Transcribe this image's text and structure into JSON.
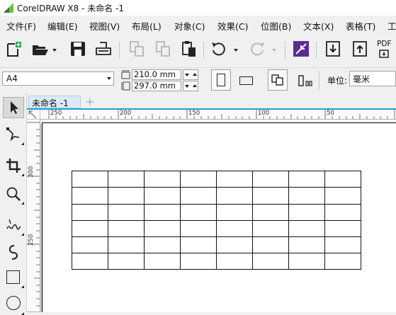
{
  "window": {
    "title": "CorelDRAW X8 - 未命名 -1"
  },
  "menu": [
    "文件(F)",
    "编辑(E)",
    "视图(V)",
    "布局(L)",
    "对象(C)",
    "效果(C)",
    "位图(B)",
    "文本(X)",
    "表格(T)",
    "工"
  ],
  "toolbar": {
    "buttons": [
      "new-document",
      "open",
      "save",
      "print",
      "import-disabled",
      "export-disabled",
      "paste",
      "undo",
      "redo",
      "welcome",
      "import",
      "export",
      "publish-to-pdf"
    ],
    "pdf_label": "PDF"
  },
  "property_bar": {
    "page_size": "A4",
    "width": "210.0 mm",
    "height": "297.0 mm",
    "unit_label": "单位:",
    "unit_value": "毫米"
  },
  "document_tabs": [
    {
      "label": "未命名 -1",
      "active": true
    }
  ],
  "rulers": {
    "horizontal_labels": [
      "250",
      "200",
      "150",
      "100",
      "50"
    ],
    "vertical_labels": [
      "300",
      "250"
    ]
  },
  "table": {
    "rows": 6,
    "cols": 8
  },
  "colors": {
    "accent": "#1ea0d8",
    "logo_green": "#6fbe44",
    "toolbar_purple": "#5b2c8f"
  }
}
